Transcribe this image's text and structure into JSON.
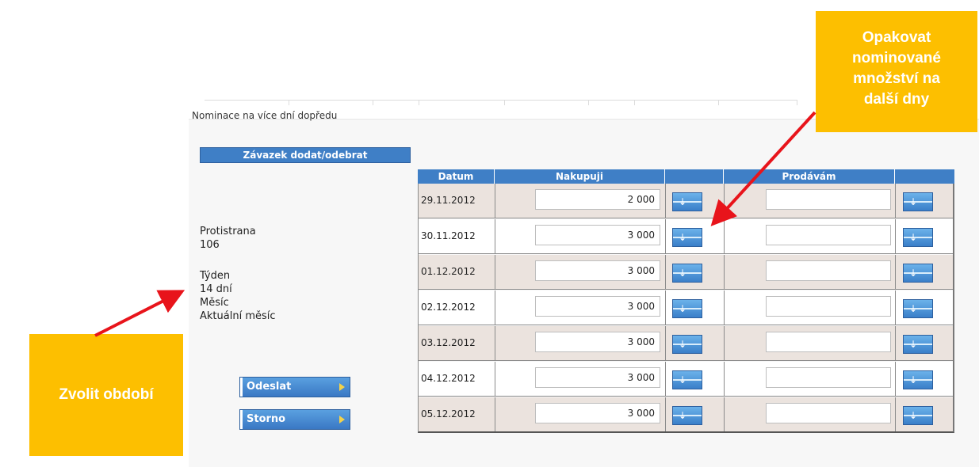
{
  "panel": {
    "title": "Nominace na více dní dopředu"
  },
  "commitment": {
    "label": "Závazek dodat/odebrat"
  },
  "counterparty": {
    "label": "Protistrana",
    "value": "106"
  },
  "period": {
    "options": [
      "Týden",
      "14 dní",
      "Měsíc",
      "Aktuální měsíc"
    ]
  },
  "actions": {
    "send": "Odeslat",
    "cancel": "Storno"
  },
  "table": {
    "headers": {
      "date": "Datum",
      "buy": "Nakupuji",
      "buy_repeat": "",
      "sell": "Prodávám",
      "sell_repeat": ""
    },
    "rows": [
      {
        "date": "29.11.2012",
        "buy": "2 000",
        "sell": ""
      },
      {
        "date": "30.11.2012",
        "buy": "3 000",
        "sell": ""
      },
      {
        "date": "01.12.2012",
        "buy": "3 000",
        "sell": ""
      },
      {
        "date": "02.12.2012",
        "buy": "3 000",
        "sell": ""
      },
      {
        "date": "03.12.2012",
        "buy": "3 000",
        "sell": ""
      },
      {
        "date": "04.12.2012",
        "buy": "3 000",
        "sell": ""
      },
      {
        "date": "05.12.2012",
        "buy": "3 000",
        "sell": ""
      }
    ],
    "repeat_icon": "arrow-down-icon"
  },
  "callouts": {
    "repeat": {
      "lines": [
        "Opakovat",
        "nominované",
        "množství na",
        "další dny"
      ]
    },
    "period": {
      "text": "Zvolit období"
    }
  },
  "colors": {
    "header_blue": "#3f7fc6",
    "callout_yellow": "#fdbf00",
    "arrow_red": "#e8141b",
    "row_alt": "#ebe3de"
  }
}
